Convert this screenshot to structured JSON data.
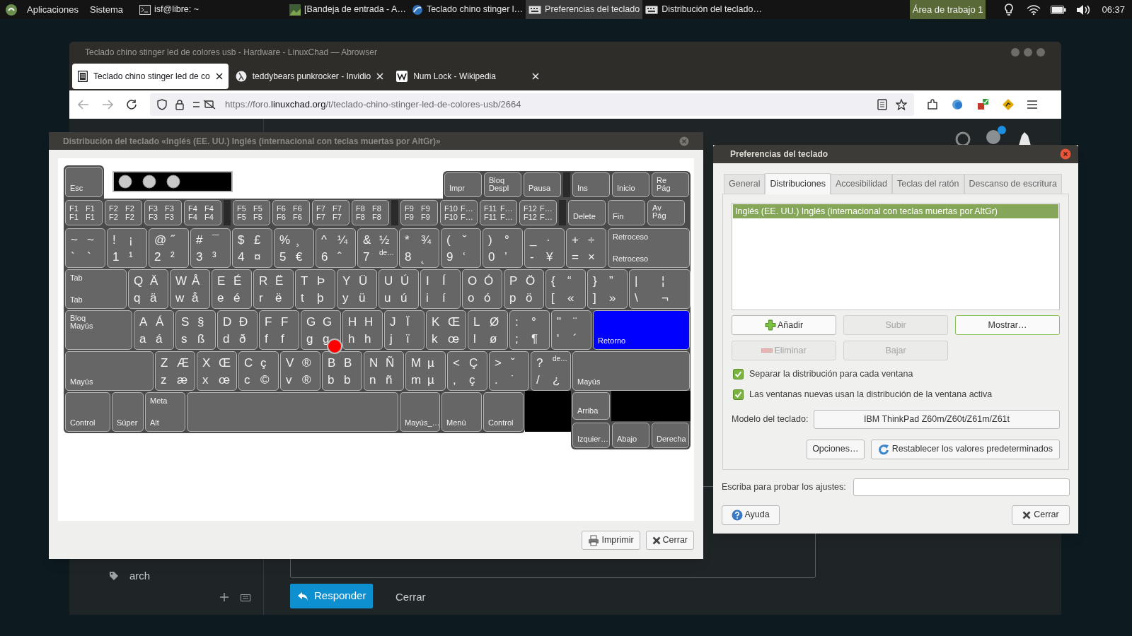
{
  "top_panel": {
    "menus": [
      "Aplicaciones",
      "Sistema"
    ],
    "tasks": [
      {
        "label": "isf@libre: ~",
        "kind": "terminal",
        "selected": false
      },
      {
        "label": "[Bandeja de entrada - A…",
        "kind": "mail",
        "selected": false
      },
      {
        "label": "Teclado chino stinger l…",
        "kind": "browser",
        "selected": false
      },
      {
        "label": "Preferencias del teclado",
        "kind": "keyboard",
        "selected": true
      },
      {
        "label": "Distribución del teclado…",
        "kind": "keyboard",
        "selected": false
      }
    ],
    "workspace": "Área de trabajo 1",
    "clock": "06:37"
  },
  "browser": {
    "title": "Teclado chino stinger led de colores usb - Hardware - LinuxChad — Abrowser",
    "tabs": [
      {
        "label": "Teclado chino stinger led de co",
        "kind": "doc",
        "selected": true
      },
      {
        "label": "teddybears punkrocker - Invidio",
        "kind": "video",
        "selected": false
      },
      {
        "label": "Num Lock - Wikipedia",
        "kind": "wiki",
        "selected": false
      }
    ],
    "url": {
      "prefix": "https://foro.",
      "domain": "linuxchad.org",
      "path": "/t/teclado-chino-stinger-led-de-colores-usb/2664"
    },
    "page": {
      "tag": "arch",
      "reply_button": "Responder",
      "close_link": "Cerrar"
    }
  },
  "keyboard_window": {
    "title": "Distribución del teclado «Inglés (EE. UU.) Inglés (internacional con teclas muertas por AltGr)»",
    "keyboard": {
      "esc": {
        "kind": "name",
        "labels": [
          "Esc"
        ],
        "pressed": false
      },
      "leds": [
        {
          "on": false
        },
        {
          "on": false
        },
        {
          "on": false
        }
      ],
      "system_keys": [
        {
          "kind": "name",
          "labels": [
            "Impr"
          ],
          "pressed": false
        },
        {
          "kind": "stack",
          "labels": [
            "Bloq Despl"
          ],
          "pressed": false
        },
        {
          "kind": "name",
          "labels": [
            "Pausa"
          ],
          "pressed": false
        }
      ],
      "edit_keys_top": [
        {
          "kind": "name",
          "labels": [
            "Ins"
          ],
          "pressed": false
        },
        {
          "kind": "name",
          "labels": [
            "Inicio"
          ],
          "pressed": false
        },
        {
          "kind": "stack",
          "labels": [
            "Re Pág"
          ],
          "pressed": false
        }
      ],
      "function_keys": [
        [
          {
            "kind": "fn",
            "labels": [
              "F1",
              "F1",
              "F1",
              "F1"
            ],
            "pressed": false
          },
          {
            "kind": "fn",
            "labels": [
              "F2",
              "F2",
              "F2",
              "F2"
            ],
            "pressed": false
          },
          {
            "kind": "fn",
            "labels": [
              "F3",
              "F3",
              "F3",
              "F3"
            ],
            "pressed": false
          },
          {
            "kind": "fn",
            "labels": [
              "F4",
              "F4",
              "F4",
              "F4"
            ],
            "pressed": false
          }
        ],
        [
          {
            "kind": "fn",
            "labels": [
              "F5",
              "F5",
              "F5",
              "F5"
            ],
            "pressed": false
          },
          {
            "kind": "fn",
            "labels": [
              "F6",
              "F6",
              "F6",
              "F6"
            ],
            "pressed": false
          },
          {
            "kind": "fn",
            "labels": [
              "F7",
              "F7",
              "F7",
              "F7"
            ],
            "pressed": false
          },
          {
            "kind": "fn",
            "labels": [
              "F8",
              "F8",
              "F8",
              "F8"
            ],
            "pressed": false
          }
        ],
        [
          {
            "kind": "fn",
            "labels": [
              "F9",
              "F9",
              "F9",
              "F9"
            ],
            "pressed": false
          },
          {
            "kind": "fn",
            "labels": [
              "F10",
              "F…",
              "F10",
              "F…"
            ],
            "pressed": false
          },
          {
            "kind": "fn",
            "labels": [
              "F11",
              "F…",
              "F11",
              "F…"
            ],
            "pressed": false
          },
          {
            "kind": "fn",
            "labels": [
              "F12",
              "F…",
              "F12",
              "F…"
            ],
            "pressed": false
          }
        ]
      ],
      "edit_keys_bottom": [
        {
          "kind": "name",
          "labels": [
            "Delete"
          ],
          "pressed": false
        },
        {
          "kind": "name",
          "labels": [
            "Fin"
          ],
          "pressed": false
        },
        {
          "kind": "stack",
          "labels": [
            "Av Pág"
          ],
          "pressed": false
        }
      ],
      "rows": [
        {
          "keys": [
            {
              "kind": "char",
              "labels": [
                "~",
                "~",
                "`",
                "`"
              ],
              "pressed": false
            },
            {
              "kind": "char",
              "labels": [
                "!",
                "¡",
                "1",
                "¹"
              ],
              "pressed": false
            },
            {
              "kind": "char",
              "labels": [
                "@",
                "˝",
                "2",
                "²"
              ],
              "pressed": false
            },
            {
              "kind": "char",
              "labels": [
                "#",
                "¯",
                "3",
                "³"
              ],
              "pressed": false
            },
            {
              "kind": "char",
              "labels": [
                "$",
                "£",
                "4",
                "¤"
              ],
              "pressed": false
            },
            {
              "kind": "char",
              "labels": [
                "%",
                "¸",
                "5",
                "€"
              ],
              "pressed": false
            },
            {
              "kind": "char",
              "labels": [
                "^",
                "¼",
                "6",
                "ˆ"
              ],
              "pressed": false
            },
            {
              "kind": "char",
              "labels": [
                "&",
                "½",
                "7",
                "de…"
              ],
              "pressed": false
            },
            {
              "kind": "char",
              "labels": [
                "*",
                "¾",
                "8",
                "˛"
              ],
              "pressed": false
            },
            {
              "kind": "char",
              "labels": [
                "(",
                "˘",
                "9",
                "‘"
              ],
              "pressed": false
            },
            {
              "kind": "char",
              "labels": [
                ")",
                "°",
                "0",
                "’"
              ],
              "pressed": false
            },
            {
              "kind": "char",
              "labels": [
                "_",
                "·",
                "-",
                "¥"
              ],
              "pressed": false
            },
            {
              "kind": "char",
              "labels": [
                "+",
                "÷",
                "=",
                "×"
              ],
              "pressed": false
            },
            {
              "kind": "name",
              "labels": [
                "Retroceso",
                "Retroceso"
              ],
              "pressed": false
            }
          ]
        },
        {
          "keys": [
            {
              "kind": "name",
              "labels": [
                "Tab",
                "Tab"
              ],
              "pressed": false
            },
            {
              "kind": "char",
              "labels": [
                "Q",
                "Ä",
                "q",
                "ä"
              ],
              "pressed": false
            },
            {
              "kind": "char",
              "labels": [
                "W",
                "Å",
                "w",
                "å"
              ],
              "pressed": false
            },
            {
              "kind": "char",
              "labels": [
                "E",
                "É",
                "e",
                "é"
              ],
              "pressed": false
            },
            {
              "kind": "char",
              "labels": [
                "R",
                "Ë",
                "r",
                "ë"
              ],
              "pressed": false
            },
            {
              "kind": "char",
              "labels": [
                "T",
                "Þ",
                "t",
                "þ"
              ],
              "pressed": false
            },
            {
              "kind": "char",
              "labels": [
                "Y",
                "Ü",
                "y",
                "ü"
              ],
              "pressed": false
            },
            {
              "kind": "char",
              "labels": [
                "U",
                "Ú",
                "u",
                "ú"
              ],
              "pressed": false
            },
            {
              "kind": "char",
              "labels": [
                "I",
                "Í",
                "i",
                "í"
              ],
              "pressed": false
            },
            {
              "kind": "char",
              "labels": [
                "O",
                "Ó",
                "o",
                "ó"
              ],
              "pressed": false
            },
            {
              "kind": "char",
              "labels": [
                "P",
                "Ö",
                "p",
                "ö"
              ],
              "pressed": false
            },
            {
              "kind": "char",
              "labels": [
                "{",
                "“",
                "[",
                "«"
              ],
              "pressed": false
            },
            {
              "kind": "char",
              "labels": [
                "}",
                "”",
                "]",
                "»"
              ],
              "pressed": false
            },
            {
              "kind": "char",
              "labels": [
                "|",
                "¦",
                "\\",
                "¬"
              ],
              "pressed": false
            }
          ]
        },
        {
          "keys": [
            {
              "kind": "stack",
              "labels": [
                "Bloq Mayús"
              ],
              "pressed": false
            },
            {
              "kind": "char",
              "labels": [
                "A",
                "Á",
                "a",
                "á"
              ],
              "pressed": false
            },
            {
              "kind": "char",
              "labels": [
                "S",
                "§",
                "s",
                "ß"
              ],
              "pressed": false
            },
            {
              "kind": "char",
              "labels": [
                "D",
                "Ð",
                "d",
                "ð"
              ],
              "pressed": false
            },
            {
              "kind": "char",
              "labels": [
                "F",
                "F",
                "f",
                "f"
              ],
              "pressed": false
            },
            {
              "kind": "char",
              "labels": [
                "G",
                "G",
                "g",
                "g"
              ],
              "pressed": false
            },
            {
              "kind": "char",
              "labels": [
                "H",
                "H",
                "h",
                "h"
              ],
              "pressed": false
            },
            {
              "kind": "char",
              "labels": [
                "J",
                "Ï",
                "j",
                "ï"
              ],
              "pressed": false
            },
            {
              "kind": "char",
              "labels": [
                "K",
                "Œ",
                "k",
                "œ"
              ],
              "pressed": false
            },
            {
              "kind": "char",
              "labels": [
                "L",
                "Ø",
                "l",
                "ø"
              ],
              "pressed": false
            },
            {
              "kind": "char",
              "labels": [
                ":",
                "°",
                ";",
                "¶"
              ],
              "pressed": false
            },
            {
              "kind": "char",
              "labels": [
                "\"",
                "¨",
                "'",
                "´"
              ],
              "pressed": false
            },
            {
              "kind": "name",
              "labels": [
                "Retorno"
              ],
              "pressed": true
            }
          ]
        },
        {
          "keys": [
            {
              "kind": "name",
              "labels": [
                "Mayús"
              ],
              "pressed": false
            },
            {
              "kind": "char",
              "labels": [
                "Z",
                "Æ",
                "z",
                "æ"
              ],
              "pressed": false
            },
            {
              "kind": "char",
              "labels": [
                "X",
                "Œ",
                "x",
                "œ"
              ],
              "pressed": false
            },
            {
              "kind": "char",
              "labels": [
                "C",
                "ç",
                "c",
                "©"
              ],
              "pressed": false
            },
            {
              "kind": "char",
              "labels": [
                "V",
                "®",
                "v",
                "®"
              ],
              "pressed": false
            },
            {
              "kind": "char",
              "labels": [
                "B",
                "B",
                "b",
                "b"
              ],
              "pressed": false
            },
            {
              "kind": "char",
              "labels": [
                "N",
                "Ñ",
                "n",
                "ñ"
              ],
              "pressed": false
            },
            {
              "kind": "char",
              "labels": [
                "M",
                "µ",
                "m",
                "µ"
              ],
              "pressed": false
            },
            {
              "kind": "char",
              "labels": [
                "<",
                "Ç",
                ",",
                "ç"
              ],
              "pressed": false
            },
            {
              "kind": "char",
              "labels": [
                ">",
                "ˇ",
                ".",
                "˙"
              ],
              "pressed": false
            },
            {
              "kind": "char",
              "labels": [
                "?",
                "de…",
                "/",
                "¿"
              ],
              "pressed": false
            },
            {
              "kind": "name",
              "labels": [
                "Mayús"
              ],
              "pressed": false
            }
          ]
        },
        {
          "keys": [
            {
              "kind": "name",
              "labels": [
                "Control"
              ],
              "pressed": false
            },
            {
              "kind": "name",
              "labels": [
                "Súper"
              ],
              "pressed": false
            },
            {
              "kind": "name",
              "labels": [
                "Meta",
                "Alt"
              ],
              "pressed": false
            },
            {
              "kind": "blank",
              "pressed": false
            },
            {
              "kind": "name",
              "labels": [
                "Mayús_…"
              ],
              "pressed": false
            },
            {
              "kind": "name",
              "labels": [
                "Menú"
              ],
              "pressed": false
            },
            {
              "kind": "name",
              "labels": [
                "Control"
              ],
              "pressed": false
            }
          ]
        }
      ],
      "arrow_up": {
        "kind": "name",
        "labels": [
          "Arriba"
        ],
        "pressed": false
      },
      "arrow_row": [
        {
          "kind": "name",
          "labels": [
            "Izquier…"
          ],
          "pressed": false
        },
        {
          "kind": "name",
          "labels": [
            "Abajo"
          ],
          "pressed": false
        },
        {
          "kind": "name",
          "labels": [
            "Derecha"
          ],
          "pressed": false
        }
      ]
    },
    "buttons": [
      {
        "label": "Imprimir",
        "kind": "print"
      },
      {
        "label": "Cerrar",
        "kind": "close"
      }
    ]
  },
  "preferences_window": {
    "title": "Preferencias del teclado",
    "tabs": [
      {
        "label": "General",
        "selected": false
      },
      {
        "label": "Distribuciones",
        "selected": true
      },
      {
        "label": "Accesibilidad",
        "selected": false
      },
      {
        "label": "Teclas del ratón",
        "selected": false
      },
      {
        "label": "Descanso de escritura",
        "selected": false
      }
    ],
    "layouts": [
      {
        "label": "Inglés (EE. UU.) Inglés (internacional con teclas muertas por AltGr)",
        "selected": true
      }
    ],
    "layout_buttons": [
      {
        "label": "Añadir",
        "kind": "add",
        "disabled": false,
        "focused": false
      },
      {
        "label": "Subir",
        "kind": "plain",
        "disabled": true,
        "focused": false
      },
      {
        "label": "Mostrar…",
        "kind": "plain",
        "disabled": false,
        "focused": true
      },
      {
        "label": "Eliminar",
        "kind": "remove",
        "disabled": true,
        "focused": false
      },
      {
        "label": "Bajar",
        "kind": "plain",
        "disabled": true,
        "focused": false
      }
    ],
    "checkboxes": [
      {
        "label": "Separar la distribución para cada ventana",
        "checked": true
      },
      {
        "label": "Las ventanas nuevas usan la distribución de la ventana activa",
        "checked": true
      }
    ],
    "model_label": "Modelo del teclado:",
    "model_button": "IBM ThinkPad Z60m/Z60t/Z61m/Z61t",
    "options_button": "Opciones…",
    "reset_button": "Restablecer los valores predeterminados",
    "test_label": "Escriba para probar los ajustes:",
    "help_button": "Ayuda",
    "close_button": "Cerrar"
  }
}
